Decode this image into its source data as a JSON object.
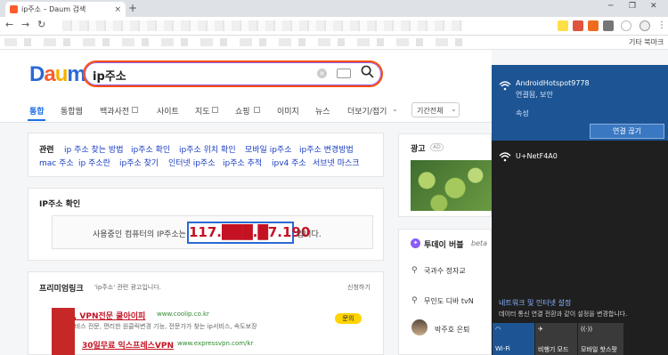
{
  "browser": {
    "tab_title": "ip주소 – Daum 검색",
    "new_tab": "+",
    "close_tab": "×",
    "other_bookmarks": "기타 북마크"
  },
  "header": {
    "logo": "Daum",
    "query": "ip주소",
    "clear": "×",
    "search_icon": "⚲"
  },
  "nav": {
    "tabs": [
      "통합",
      "통합웹",
      "백과사전",
      "사이트",
      "지도",
      "쇼핑",
      "이미지",
      "뉴스",
      "더보기/접기",
      "기간전체"
    ]
  },
  "related": {
    "title": "관련",
    "row1": [
      "ip 주소 찾는 방법",
      "ip주소 확인",
      "ip주소 위치 확인",
      "모바일 ip주소",
      "ip주소 변경방법"
    ],
    "row2": [
      "mac 주소",
      "ip 주소란",
      "ip주소 찾기",
      "인터넷 ip주소",
      "ip주소 추적",
      "ipv4 주소",
      "서브넷 마스크"
    ]
  },
  "ipcheck": {
    "title": "IP주소 확인",
    "prefix": "사용중인 컴퓨터의 IP주소는",
    "value": "117.███.█7.190",
    "suffix": "입니다."
  },
  "premium": {
    "title": "프리미엄링크",
    "subtitle": "'ip주소' 관련 광고입니다.",
    "apply": "신청하기",
    "ad1_title": "아이피, VPN전문 쿨아이피",
    "ad1_url": "www.coolip.co.kr",
    "ad1_desc": "아이피서비스 전문, 편리한 원클릭변경 기능, 전문가가 찾는 ip서비스, 속도보장",
    "ad1_badge": "문의",
    "ad2_title": "30일무료 익스프레스VPN",
    "ad2_url": "www.expressvpn.com/kr"
  },
  "side": {
    "ad_title": "광고",
    "ad_badge": "AD",
    "trend_title": "투데이 버블",
    "trend_beta": "beta",
    "trend_items": [
      "국과수 정자교",
      "무인도 디바 tvN",
      "박주호 은퇴"
    ]
  },
  "wifi": {
    "network1": "AndroidHotspot9778",
    "network1_status": "연결됨, 보안",
    "properties": "속성",
    "disconnect": "연결 끊기",
    "network2": "U+NetF4A0",
    "settings_title": "네트워크 및 인터넷 설정",
    "settings_desc": "데이터 통신 연결 전환과 같이 설정을 변경합니다.",
    "tiles": [
      "Wi-Fi",
      "비행기 모드",
      "모바일 핫스팟"
    ]
  },
  "colors": {
    "accent": "#1e6ee6",
    "ip_red": "#c41222",
    "wifi_blue": "#1d5594"
  }
}
